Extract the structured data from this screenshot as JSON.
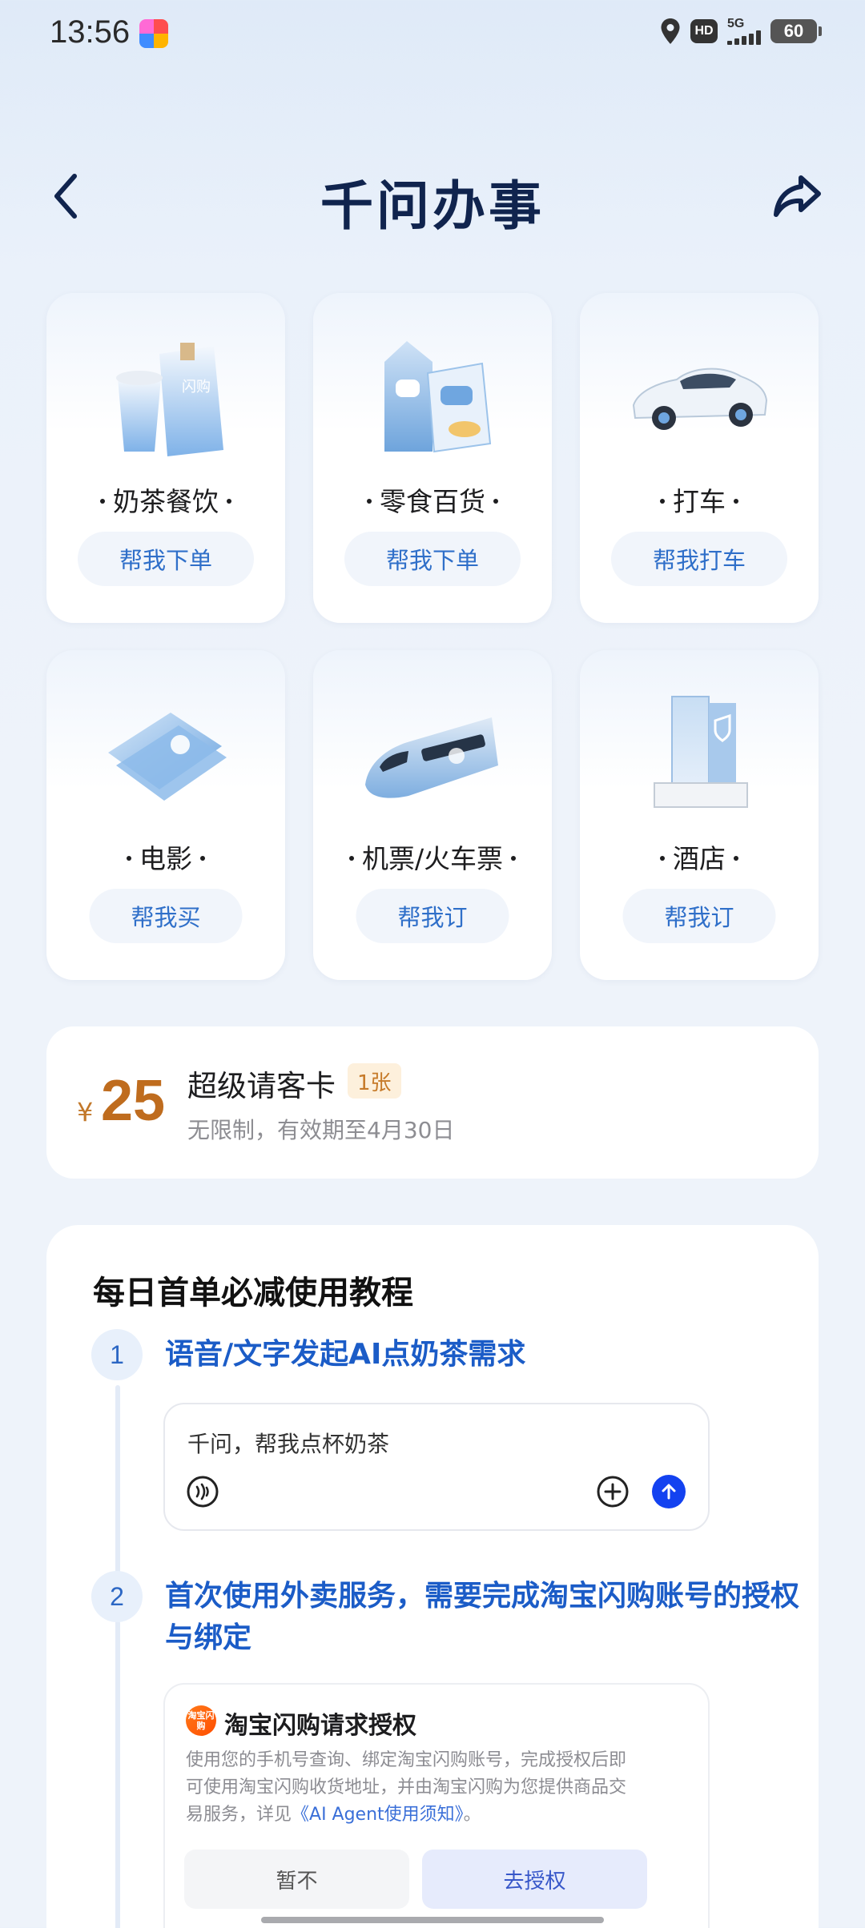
{
  "status_bar": {
    "time": "13:56",
    "app_icon": "app-notification-icon",
    "hd": "HD",
    "network": "5G",
    "battery": "60"
  },
  "header": {
    "title": "千问办事",
    "back_icon": "back-chevron-icon",
    "share_icon": "share-arrow-icon"
  },
  "services": [
    {
      "name": "奶茶餐饮",
      "action": "帮我下单",
      "icon": "milk-tea-icon"
    },
    {
      "name": "零食百货",
      "action": "帮我下单",
      "icon": "snack-icon"
    },
    {
      "name": "打车",
      "action": "帮我打车",
      "icon": "car-icon"
    },
    {
      "name": "电影",
      "action": "帮我买",
      "icon": "movie-ticket-icon"
    },
    {
      "name": "机票/火车票",
      "action": "帮我订",
      "icon": "train-icon"
    },
    {
      "name": "酒店",
      "action": "帮我订",
      "icon": "hotel-icon"
    }
  ],
  "coupon": {
    "currency": "¥",
    "amount": "25",
    "title": "超级请客卡",
    "badge": "1张",
    "desc": "无限制，有效期至4月30日"
  },
  "tutorial": {
    "title": "每日首单必减使用教程",
    "steps": [
      {
        "num": "1",
        "text": "语音/文字发起AI点奶茶需求"
      },
      {
        "num": "2",
        "text_line1": "首次使用外卖服务，需要完成淘宝闪购账号的授权",
        "text_line2": "与绑定"
      }
    ],
    "demo_input": "千问，帮我点杯奶茶",
    "auth": {
      "logo_text": "淘宝闪购",
      "title": "淘宝闪购请求授权",
      "desc_line1": "使用您的手机号查询、绑定淘宝闪购账号，完成授权后即",
      "desc_line2": "可使用淘宝闪购收货地址，并由淘宝闪购为您提供商品交",
      "desc_prefix": "易服务，详见",
      "desc_link": "《AI Agent使用须知》",
      "desc_suffix": "。",
      "later_label": "暂不",
      "go_label": "去授权"
    }
  }
}
